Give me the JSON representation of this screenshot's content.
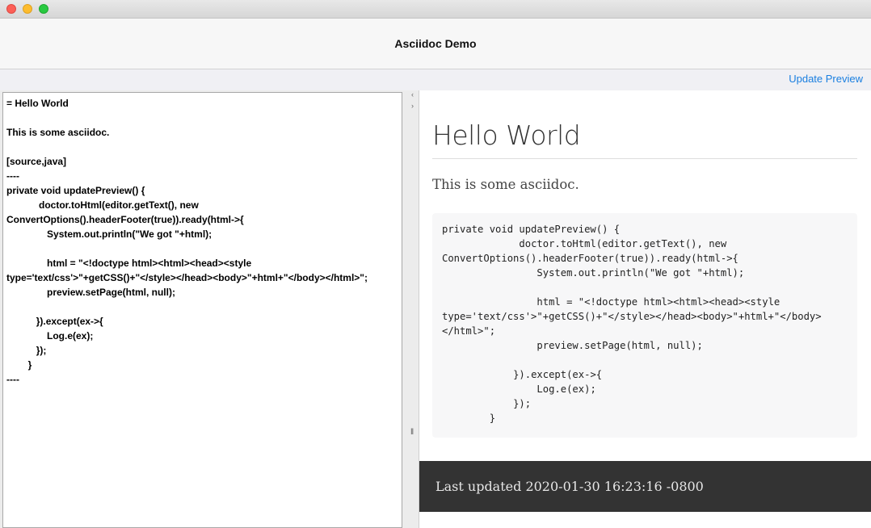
{
  "window": {
    "title": "Asciidoc Demo"
  },
  "toolbar": {
    "update_preview_label": "Update Preview"
  },
  "editor": {
    "source": "= Hello World\n\nThis is some asciidoc.\n\n[source,java]\n----\nprivate void updatePreview() {\n            doctor.toHtml(editor.getText(), new\nConvertOptions().headerFooter(true)).ready(html->{\n               System.out.println(\"We got \"+html);\n\n               html = \"<!doctype html><html><head><style\ntype='text/css'>\"+getCSS()+\"</style></head><body>\"+html+\"</body></html>\";\n               preview.setPage(html, null);\n\n           }).except(ex->{\n               Log.e(ex);\n           });\n        }\n----"
  },
  "divider": {
    "left_arrow": "‹",
    "right_arrow": "›",
    "grip": "‖"
  },
  "preview": {
    "heading": "Hello World",
    "paragraph": "This is some asciidoc.",
    "code": "private void updatePreview() {\n             doctor.toHtml(editor.getText(), new\nConvertOptions().headerFooter(true)).ready(html->{\n                System.out.println(\"We got \"+html);\n\n                html = \"<!doctype html><html><head><style\ntype='text/css'>\"+getCSS()+\"</style></head><body>\"+html+\"</body>\n</html>\";\n                preview.setPage(html, null);\n\n            }).except(ex->{\n                Log.e(ex);\n            });\n        }",
    "footer": "Last updated 2020-01-30 16:23:16 -0800"
  }
}
